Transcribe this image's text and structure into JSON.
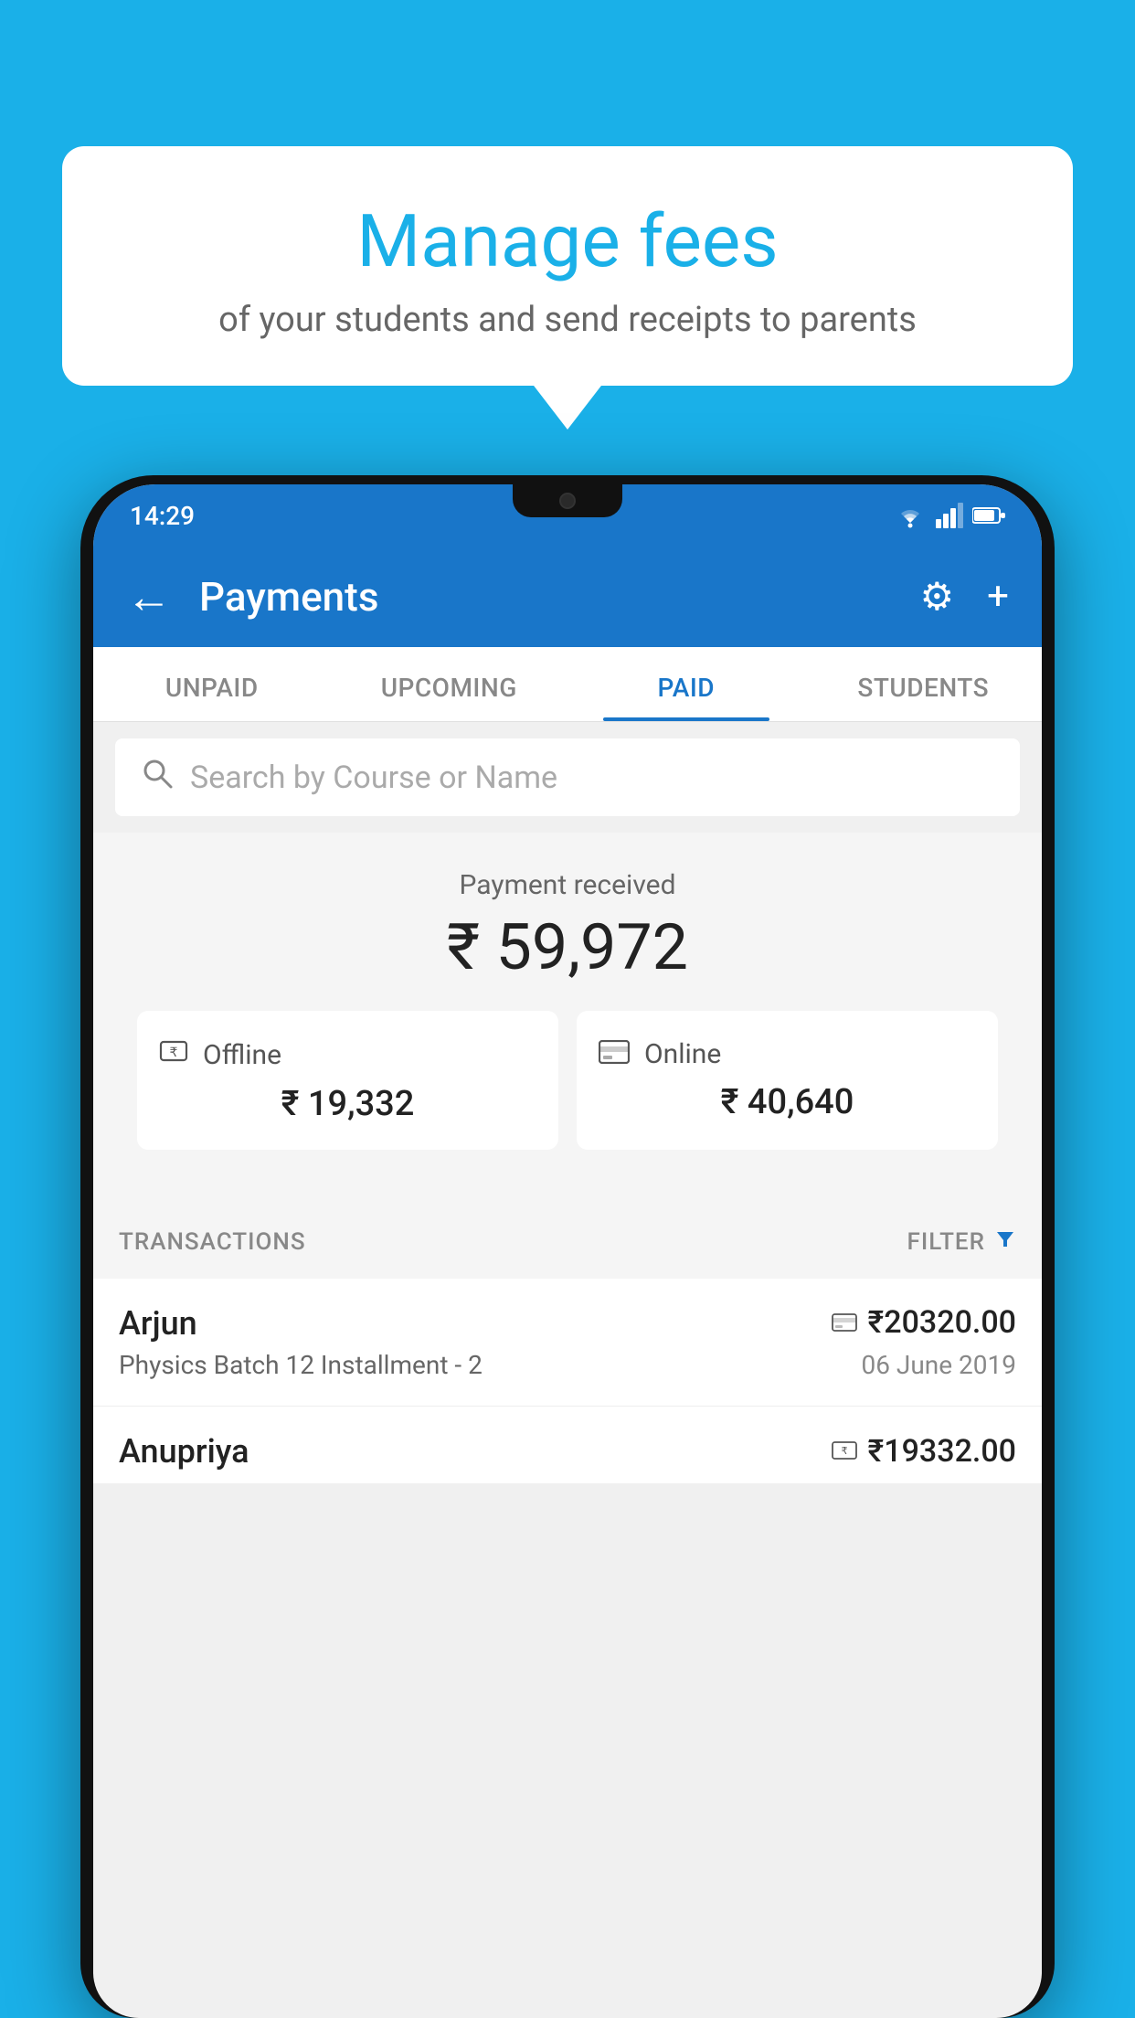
{
  "background_color": "#1ab0e8",
  "tooltip": {
    "title": "Manage fees",
    "subtitle": "of your students and send receipts to parents"
  },
  "status_bar": {
    "time": "14:29",
    "icons": [
      "wifi",
      "signal",
      "battery"
    ]
  },
  "app_bar": {
    "title": "Payments",
    "back_label": "←",
    "settings_label": "⚙",
    "add_label": "+"
  },
  "tabs": [
    {
      "label": "UNPAID",
      "active": false
    },
    {
      "label": "UPCOMING",
      "active": false
    },
    {
      "label": "PAID",
      "active": true
    },
    {
      "label": "STUDENTS",
      "active": false
    }
  ],
  "search": {
    "placeholder": "Search by Course or Name"
  },
  "payment_summary": {
    "label": "Payment received",
    "amount": "₹ 59,972",
    "offline": {
      "label": "Offline",
      "amount": "₹ 19,332"
    },
    "online": {
      "label": "Online",
      "amount": "₹ 40,640"
    }
  },
  "transactions": {
    "header_label": "TRANSACTIONS",
    "filter_label": "FILTER",
    "items": [
      {
        "name": "Arjun",
        "amount": "₹20320.00",
        "course": "Physics Batch 12 Installment - 2",
        "date": "06 June 2019",
        "payment_type": "online"
      },
      {
        "name": "Anupriya",
        "amount": "₹19332.00",
        "course": "",
        "date": "",
        "payment_type": "offline"
      }
    ]
  }
}
